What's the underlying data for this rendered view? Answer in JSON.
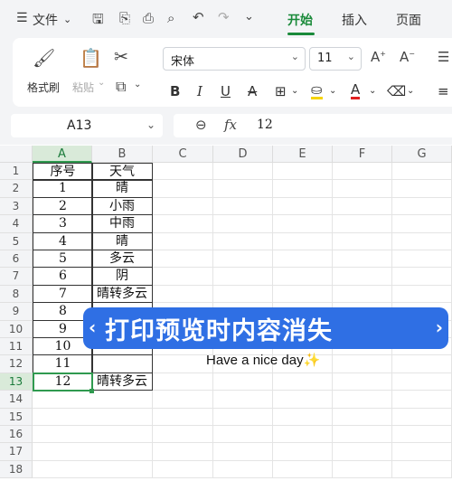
{
  "menubar": {
    "menu_icon": "☰",
    "file_label": "文件",
    "tabs": [
      "开始",
      "插入",
      "页面"
    ]
  },
  "ribbon": {
    "format_painter_label": "格式刷",
    "paste_label": "粘贴",
    "font_name": "宋体",
    "font_size": "11"
  },
  "formula_bar": {
    "name_box": "A13",
    "fx_label": "fx",
    "formula_value": "12"
  },
  "sheet": {
    "columns": [
      "A",
      "B",
      "C",
      "D",
      "E",
      "F",
      "G"
    ],
    "rows": [
      "1",
      "2",
      "3",
      "4",
      "5",
      "6",
      "7",
      "8",
      "9",
      "10",
      "11",
      "12",
      "13",
      "14",
      "15",
      "16",
      "17",
      "18"
    ],
    "header": [
      "序号",
      "天气"
    ],
    "data": [
      [
        "1",
        "晴"
      ],
      [
        "2",
        "小雨"
      ],
      [
        "3",
        "中雨"
      ],
      [
        "4",
        "晴"
      ],
      [
        "5",
        "多云"
      ],
      [
        "6",
        "阴"
      ],
      [
        "7",
        "晴转多云"
      ],
      [
        "8",
        ""
      ],
      [
        "9",
        ""
      ],
      [
        "10",
        ""
      ],
      [
        "11",
        ""
      ],
      [
        "12",
        "晴转多云"
      ]
    ],
    "active_cell": "A13"
  },
  "overlay": {
    "title": "打印预览时内容消失",
    "subtitle": "Have a nice day",
    "sparkle": "✨"
  },
  "colors": {
    "accent_green": "#1a8a3a",
    "banner_blue": "#2f6fe4"
  }
}
